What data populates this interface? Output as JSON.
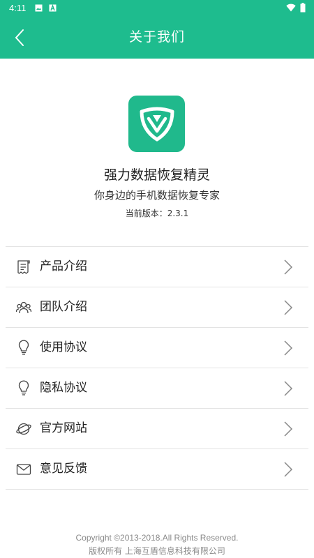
{
  "status_bar": {
    "time": "4:11",
    "icons": [
      "image-icon",
      "a-icon",
      "wifi-icon",
      "battery-icon"
    ]
  },
  "app_bar": {
    "title": "关于我们",
    "back_icon": "back-arrow-icon"
  },
  "app_info": {
    "name": "强力数据恢复精灵",
    "slogan": "你身边的手机数据恢复专家",
    "version": "当前版本：2.3.1"
  },
  "menu": {
    "items": [
      {
        "label": "产品介绍",
        "icon": "document-icon"
      },
      {
        "label": "团队介绍",
        "icon": "team-icon"
      },
      {
        "label": "使用协议",
        "icon": "lightbulb-icon"
      },
      {
        "label": "隐私协议",
        "icon": "lightbulb-icon"
      },
      {
        "label": "官方网站",
        "icon": "planet-icon"
      },
      {
        "label": "意见反馈",
        "icon": "mail-icon"
      }
    ]
  },
  "footer": {
    "copyright": "Copyright ©2013-2018.All Rights Reserved.",
    "company": "版权所有 上海互盾信息科技有限公司"
  },
  "colors": {
    "primary": "#1ebc8e",
    "text": "#222222",
    "divider": "#e3e3e3",
    "footer_text": "#8a8a8a"
  }
}
